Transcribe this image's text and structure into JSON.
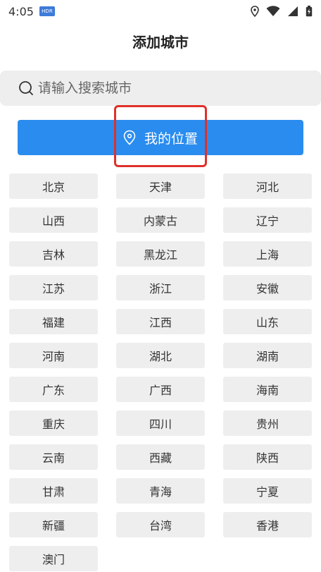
{
  "status_bar": {
    "time": "4:05",
    "app_badge": "HDR",
    "icons": [
      "location-icon",
      "wifi-icon",
      "signal-icon",
      "battery-icon"
    ]
  },
  "header": {
    "title": "添加城市"
  },
  "search": {
    "placeholder": "请输入搜索城市",
    "value": ""
  },
  "location": {
    "label": "我的位置",
    "highlight_color": "#e0302b"
  },
  "colors": {
    "accent": "#2a8cee",
    "chip_bg": "#eeeeee"
  },
  "cities": [
    "北京",
    "天津",
    "河北",
    "山西",
    "内蒙古",
    "辽宁",
    "吉林",
    "黑龙江",
    "上海",
    "江苏",
    "浙江",
    "安徽",
    "福建",
    "江西",
    "山东",
    "河南",
    "湖北",
    "湖南",
    "广东",
    "广西",
    "海南",
    "重庆",
    "四川",
    "贵州",
    "云南",
    "西藏",
    "陕西",
    "甘肃",
    "青海",
    "宁夏",
    "新疆",
    "台湾",
    "香港",
    "澳门"
  ]
}
